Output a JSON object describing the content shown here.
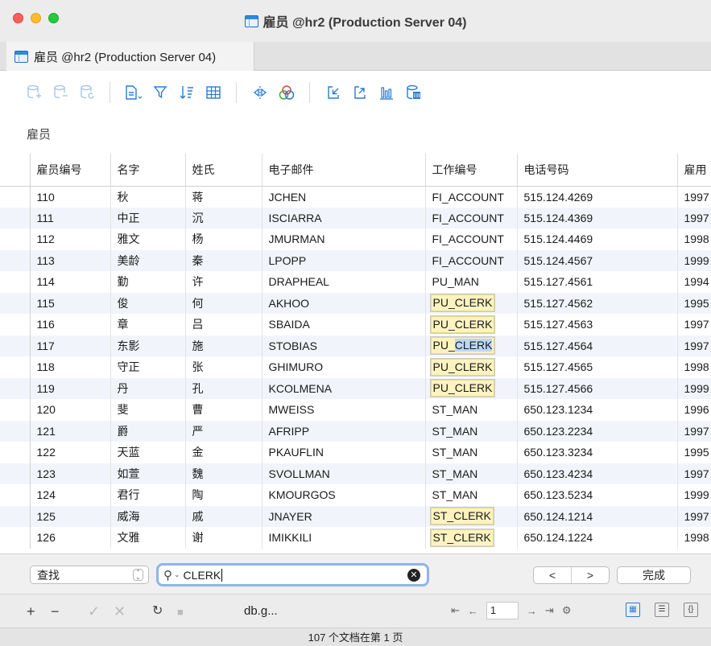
{
  "window": {
    "title": "雇员 @hr2 (Production Server 04)"
  },
  "tab": {
    "label": "雇员 @hr2 (Production Server 04)"
  },
  "section_label": "雇员",
  "columns": [
    "雇员编号",
    "名字",
    "姓氏",
    "电子邮件",
    "工作编号",
    "电话号码",
    "雇用"
  ],
  "rows": [
    [
      "110",
      "秋",
      "蒋",
      "JCHEN",
      "FI_ACCOUNT",
      "515.124.4269",
      "1997"
    ],
    [
      "111",
      "中正",
      "沉",
      "ISCIARRA",
      "FI_ACCOUNT",
      "515.124.4369",
      "1997"
    ],
    [
      "112",
      "雅文",
      "杨",
      "JMURMAN",
      "FI_ACCOUNT",
      "515.124.4469",
      "1998"
    ],
    [
      "113",
      "美龄",
      "秦",
      "LPOPP",
      "FI_ACCOUNT",
      "515.124.4567",
      "1999"
    ],
    [
      "114",
      "勤",
      "许",
      "DRAPHEAL",
      "PU_MAN",
      "515.127.4561",
      "1994"
    ],
    [
      "115",
      "俊",
      "何",
      "AKHOO",
      "PU_CLERK",
      "515.127.4562",
      "1995"
    ],
    [
      "116",
      "章",
      "吕",
      "SBAIDA",
      "PU_CLERK",
      "515.127.4563",
      "1997"
    ],
    [
      "117",
      "东影",
      "施",
      "STOBIAS",
      "PU_CLERK",
      "515.127.4564",
      "1997"
    ],
    [
      "118",
      "守正",
      "张",
      "GHIMURO",
      "PU_CLERK",
      "515.127.4565",
      "1998"
    ],
    [
      "119",
      "丹",
      "孔",
      "KCOLMENA",
      "PU_CLERK",
      "515.127.4566",
      "1999"
    ],
    [
      "120",
      "斐",
      "曹",
      "MWEISS",
      "ST_MAN",
      "650.123.1234",
      "1996"
    ],
    [
      "121",
      "爵",
      "严",
      "AFRIPP",
      "ST_MAN",
      "650.123.2234",
      "1997"
    ],
    [
      "122",
      "天蓝",
      "金",
      "PKAUFLIN",
      "ST_MAN",
      "650.123.3234",
      "1995"
    ],
    [
      "123",
      "如萱",
      "魏",
      "SVOLLMAN",
      "ST_MAN",
      "650.123.4234",
      "1997"
    ],
    [
      "124",
      "君行",
      "陶",
      "KMOURGOS",
      "ST_MAN",
      "650.123.5234",
      "1999"
    ],
    [
      "125",
      "威海",
      "戚",
      "JNAYER",
      "ST_CLERK",
      "650.124.1214",
      "1997"
    ],
    [
      "126",
      "文雅",
      "谢",
      "IMIKKILI",
      "ST_CLERK",
      "650.124.1224",
      "1998"
    ]
  ],
  "find": {
    "mode": "查找",
    "query": "CLERK",
    "prev": "<",
    "next": ">",
    "done": "完成"
  },
  "bottom": {
    "db_name": "db.g...",
    "page": "1",
    "status": "107 个文档在第 1 页"
  }
}
